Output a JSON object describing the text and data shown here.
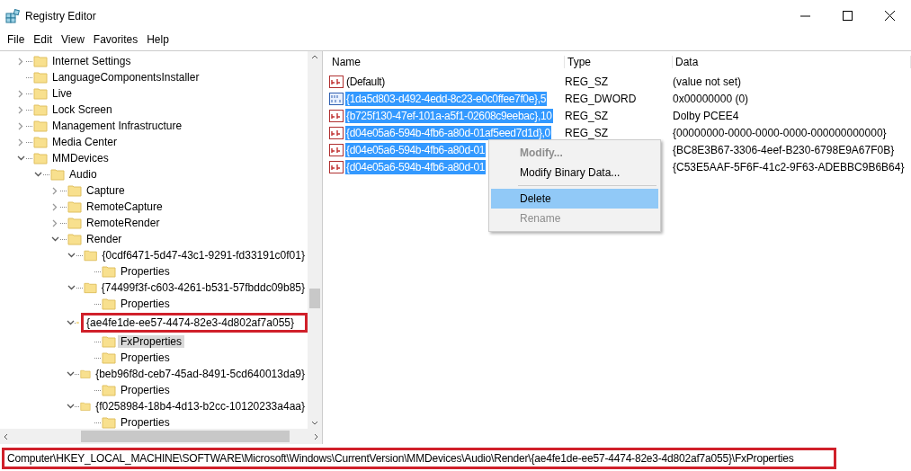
{
  "window": {
    "title": "Registry Editor"
  },
  "menu_bar": [
    "File",
    "Edit",
    "View",
    "Favorites",
    "Help"
  ],
  "tree": [
    {
      "label": "Internet Settings",
      "expanded": false,
      "selected": false
    },
    {
      "label": "LanguageComponentsInstaller",
      "selected": false
    },
    {
      "label": "Live",
      "expanded": false,
      "selected": false
    },
    {
      "label": "Lock Screen",
      "expanded": false,
      "selected": false
    },
    {
      "label": "Management Infrastructure",
      "expanded": false,
      "selected": false
    },
    {
      "label": "Media Center",
      "expanded": false,
      "selected": false
    },
    {
      "label": "MMDevices",
      "expanded": true,
      "selected": false,
      "children": [
        {
          "label": "Audio",
          "expanded": true,
          "selected": false,
          "children": [
            {
              "label": "Capture",
              "expanded": false,
              "selected": false
            },
            {
              "label": "RemoteCapture",
              "expanded": false,
              "selected": false
            },
            {
              "label": "RemoteRender",
              "expanded": false,
              "selected": false
            },
            {
              "label": "Render",
              "expanded": true,
              "selected": false,
              "children": [
                {
                  "label": "{0cdf6471-5d47-43c1-9291-fd33191c0f01}",
                  "expanded": true,
                  "selected": false,
                  "children": [
                    {
                      "label": "Properties",
                      "selected": false
                    }
                  ]
                },
                {
                  "label": "{74499f3f-c603-4261-b531-57fbddc09b85}",
                  "expanded": true,
                  "selected": false,
                  "children": [
                    {
                      "label": "Properties",
                      "selected": false
                    }
                  ]
                },
                {
                  "label": "{ae4fe1de-ee57-4474-82e3-4d802af7a055}",
                  "expanded": true,
                  "selected": false,
                  "highlighted": true,
                  "children": [
                    {
                      "label": "FxProperties",
                      "selected": true
                    },
                    {
                      "label": "Properties",
                      "selected": false
                    }
                  ]
                },
                {
                  "label": "{beb96f8d-ceb7-45ad-8491-5cd640013da9}",
                  "expanded": true,
                  "selected": false,
                  "children": [
                    {
                      "label": "Properties",
                      "selected": false
                    }
                  ]
                },
                {
                  "label": "{f0258984-18b4-4d13-b2cc-10120233a4aa}",
                  "expanded": true,
                  "selected": false,
                  "children": [
                    {
                      "label": "Properties",
                      "selected": false
                    }
                  ]
                }
              ]
            }
          ]
        }
      ]
    }
  ],
  "values": {
    "columns": [
      "Name",
      "Type",
      "Data"
    ],
    "rows": [
      {
        "kind": "string",
        "name": "(Default)",
        "type": "REG_SZ",
        "data": "(value not set)",
        "selected": false
      },
      {
        "kind": "binary",
        "name": "{1da5d803-d492-4edd-8c23-e0c0ffee7f0e},5",
        "type": "REG_DWORD",
        "data": "0x00000000 (0)",
        "selected": true
      },
      {
        "kind": "string",
        "name": "{b725f130-47ef-101a-a5f1-02608c9eebac},10",
        "type": "REG_SZ",
        "data": "Dolby PCEE4",
        "selected": true
      },
      {
        "kind": "string",
        "name": "{d04e05a6-594b-4fb6-a80d-01af5eed7d1d},0",
        "type": "REG_SZ",
        "data": "{00000000-0000-0000-0000-000000000000}",
        "selected": true
      },
      {
        "kind": "string",
        "name": "{d04e05a6-594b-4fb6-a80d-01",
        "data": "{BC8E3B67-3306-4eef-B230-6798E9A67F0B}",
        "selected": true
      },
      {
        "kind": "string",
        "name": "{d04e05a6-594b-4fb6-a80d-01",
        "data": "{C53E5AAF-5F6F-41c2-9F63-ADEBBC9B6B64}",
        "selected": true
      }
    ]
  },
  "context_menu": [
    {
      "label": "Modify...",
      "disabled": true,
      "default": true,
      "selected": false,
      "separator_before": false
    },
    {
      "label": "Modify Binary Data...",
      "disabled": false,
      "default": false,
      "selected": false,
      "separator_before": false
    },
    {
      "label": "Delete",
      "disabled": false,
      "default": false,
      "selected": true,
      "separator_before": true
    },
    {
      "label": "Rename",
      "disabled": true,
      "default": false,
      "selected": false,
      "separator_before": false
    }
  ],
  "status_bar": {
    "path": "Computer\\HKEY_LOCAL_MACHINE\\SOFTWARE\\Microsoft\\Windows\\CurrentVersion\\MMDevices\\Audio\\Render\\{ae4fe1de-ee57-4474-82e3-4d802af7a055}\\FxProperties",
    "highlighted": true
  }
}
